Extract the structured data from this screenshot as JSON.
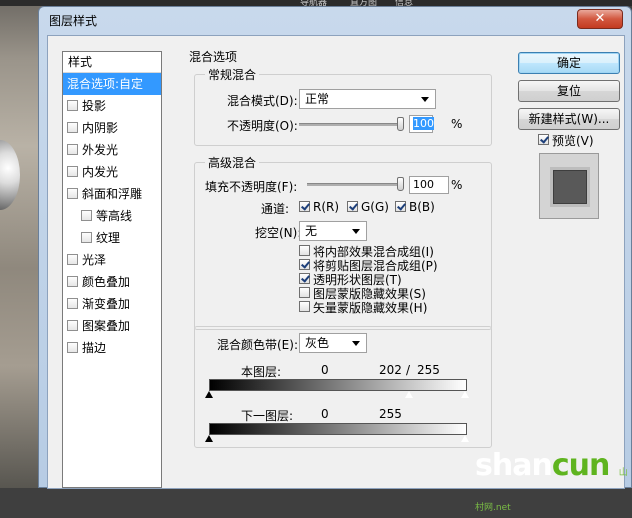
{
  "window": {
    "title": "图层样式",
    "close": "✕"
  },
  "background": {
    "top_tabs": [
      "导航器",
      "直方图",
      "信息"
    ]
  },
  "styles": {
    "header": "样式",
    "items": [
      {
        "label": "混合选项:自定",
        "selected": true,
        "checkbox": false,
        "indent": false
      },
      {
        "label": "投影",
        "checkbox": true,
        "indent": false
      },
      {
        "label": "内阴影",
        "checkbox": true,
        "indent": false
      },
      {
        "label": "外发光",
        "checkbox": true,
        "indent": false
      },
      {
        "label": "内发光",
        "checkbox": true,
        "indent": false
      },
      {
        "label": "斜面和浮雕",
        "checkbox": true,
        "indent": false
      },
      {
        "label": "等高线",
        "checkbox": true,
        "indent": true
      },
      {
        "label": "纹理",
        "checkbox": true,
        "indent": true
      },
      {
        "label": "光泽",
        "checkbox": true,
        "indent": false
      },
      {
        "label": "颜色叠加",
        "checkbox": true,
        "indent": false
      },
      {
        "label": "渐变叠加",
        "checkbox": true,
        "indent": false
      },
      {
        "label": "图案叠加",
        "checkbox": true,
        "indent": false
      },
      {
        "label": "描边",
        "checkbox": true,
        "indent": false
      }
    ]
  },
  "blend_options": {
    "title": "混合选项",
    "general": {
      "title": "常规混合",
      "mode_label": "混合模式(D):",
      "mode_value": "正常",
      "opacity_label": "不透明度(O):",
      "opacity_value": "100",
      "percent": "%"
    },
    "advanced": {
      "title": "高级混合",
      "fill_label": "填充不透明度(F):",
      "fill_value": "100",
      "percent": "%",
      "channels_label": "通道:",
      "channels": [
        {
          "label": "R(R)",
          "checked": true
        },
        {
          "label": "G(G)",
          "checked": true
        },
        {
          "label": "B(B)",
          "checked": true
        }
      ],
      "knockout_label": "挖空(N):",
      "knockout_value": "无",
      "options": [
        {
          "label": "将内部效果混合成组(I)",
          "checked": false
        },
        {
          "label": "将剪贴图层混合成组(P)",
          "checked": true
        },
        {
          "label": "透明形状图层(T)",
          "checked": true
        },
        {
          "label": "图层蒙版隐藏效果(S)",
          "checked": false
        },
        {
          "label": "矢量蒙版隐藏效果(H)",
          "checked": false
        }
      ]
    },
    "blend_if": {
      "label": "混合颜色带(E):",
      "value": "灰色",
      "this_layer": {
        "label": "本图层:",
        "low": "0",
        "high_split": "202",
        "slash": "/",
        "high": "255"
      },
      "underlying_layer": {
        "label": "下一图层:",
        "low": "0",
        "high": "255"
      }
    }
  },
  "buttons": {
    "ok": "确定",
    "reset": "复位",
    "new_style": "新建样式(W)...",
    "preview": "预览(V)",
    "preview_checked": true
  },
  "watermark": {
    "main_a": "shan",
    "main_b": "cun",
    "sub": "山村网",
    "net": ".net"
  }
}
